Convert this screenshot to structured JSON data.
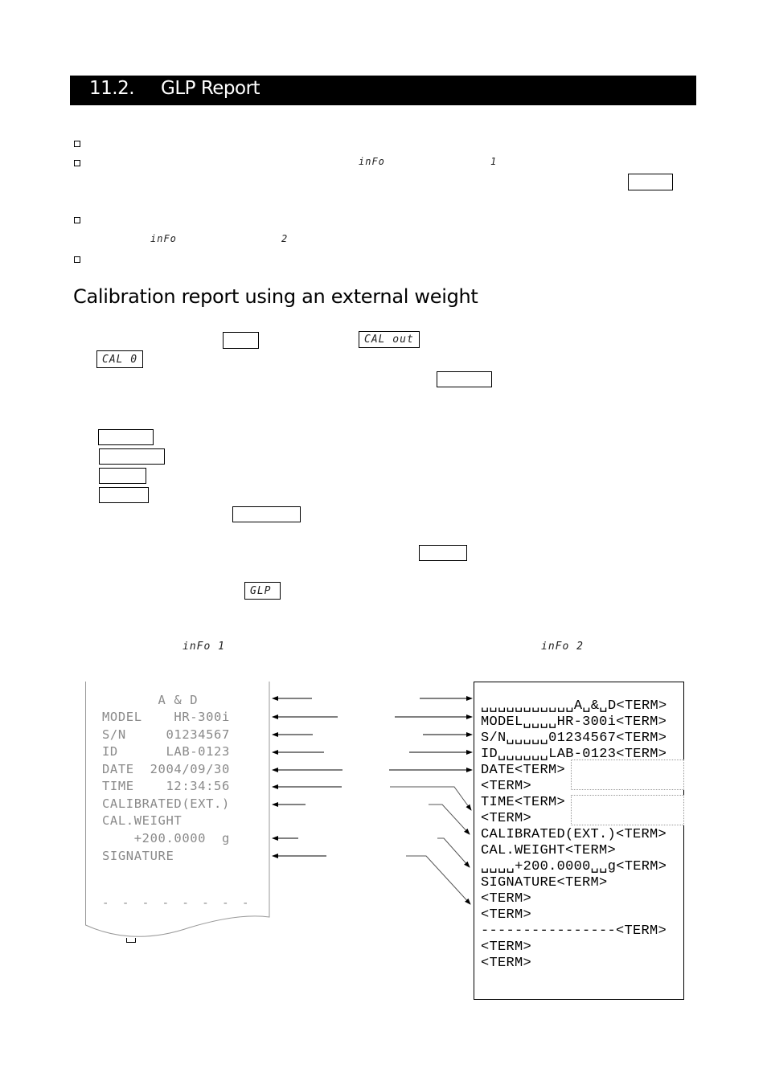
{
  "header": {
    "section_number": "11.2.",
    "title": "GLP Report"
  },
  "bullets": [
    {
      "id": "b1"
    },
    {
      "id": "b2",
      "lcd_segments": [
        "inFo",
        "1"
      ]
    },
    {
      "id": "b3",
      "lcd_segments": [
        "inFo",
        "2"
      ]
    },
    {
      "id": "b4"
    }
  ],
  "subsection": {
    "title": "Calibration report using an external weight"
  },
  "lcd_displays": {
    "cal_out": "CAL out",
    "cal_0": "CAL 0",
    "glp": "GLP",
    "info_1": "inFo  1",
    "info_2": "inFo 2"
  },
  "printout": {
    "lines": [
      "       A & D",
      "MODEL    HR-300i",
      "S/N     01234567",
      "ID      LAB-0123",
      "DATE  2004/09/30",
      "TIME    12:34:56",
      "CALIBRATED(EXT.)",
      "CAL.WEIGHT",
      "    +200.0000  g",
      "SIGNATURE"
    ],
    "signature_line": "- - - - - - - -"
  },
  "data_format": {
    "lines": [
      "␣␣␣␣␣␣␣␣␣␣␣A␣&␣D<TERM>",
      "MODEL␣␣␣␣HR-300i<TERM>",
      "S/N␣␣␣␣␣01234567<TERM>",
      "ID␣␣␣␣␣␣LAB-0123<TERM>",
      "DATE<TERM>",
      "<TERM>",
      "TIME<TERM>",
      "<TERM>",
      "CALIBRATED(EXT.)<TERM>",
      "CAL.WEIGHT<TERM>",
      "␣␣␣␣+200.0000␣␣g<TERM>",
      "SIGNATURE<TERM>",
      "<TERM>",
      "<TERM>",
      "----------------<TERM>",
      "<TERM>",
      "<TERM>"
    ]
  },
  "icons": {
    "bullet": "square-bullet",
    "space": "space-symbol",
    "arrow": "arrow"
  }
}
